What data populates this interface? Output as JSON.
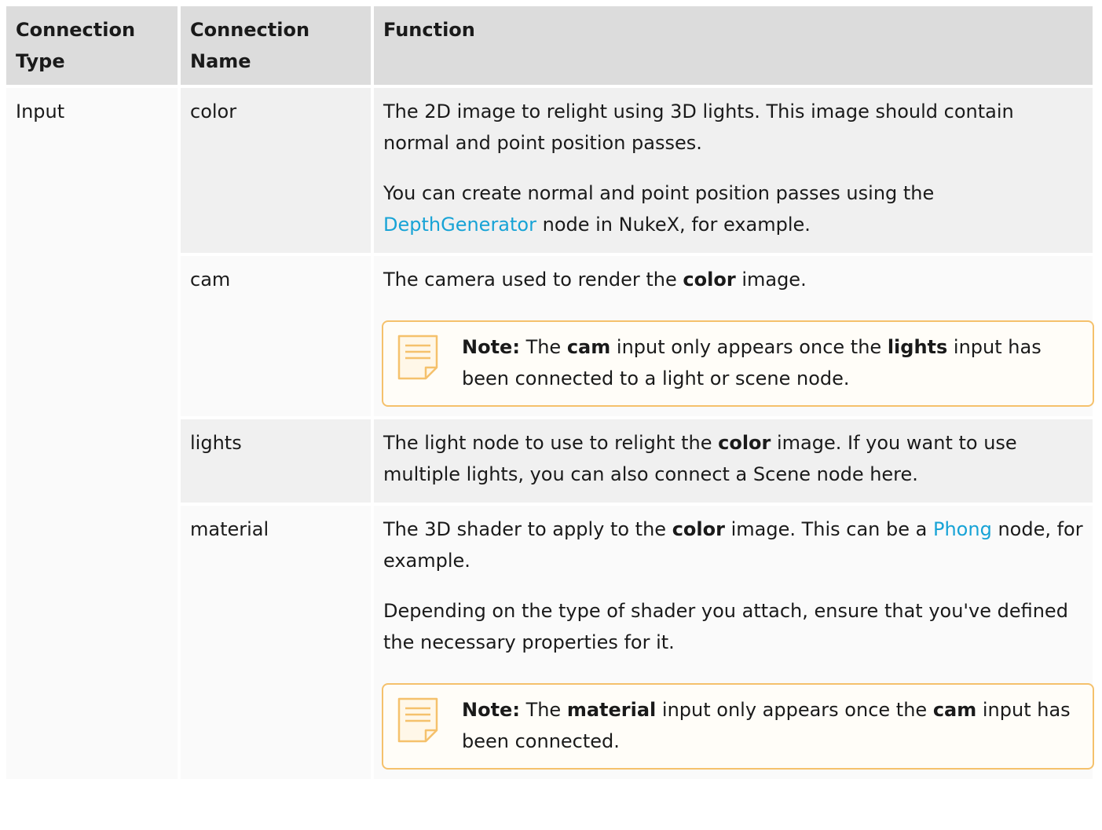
{
  "table": {
    "headers": [
      "Connection Type",
      "Connection Name",
      "Function"
    ],
    "rows": [
      {
        "type": "Input",
        "name": "color",
        "p1": "The 2D image to relight using 3D lights. This image should contain normal and point position passes.",
        "p2_pre": "You can create normal and point position passes using the ",
        "p2_link": "DepthGenerator",
        "p2_post": " node in NukeX, for example."
      },
      {
        "name": "cam",
        "p1_pre": "The camera used to render the ",
        "p1_bold": "color",
        "p1_post": " image.",
        "note": {
          "label": "Note:",
          "t1": " The ",
          "b1": "cam",
          "t2": " input only appears once the ",
          "b2": "lights",
          "t3": " input has been connected to a light or scene node."
        }
      },
      {
        "name": "lights",
        "p1_pre": "The light node to use to relight the ",
        "p1_bold": "color",
        "p1_post": " image. If you want to use multiple lights, you can also connect a Scene node here."
      },
      {
        "name": "material",
        "p1_pre": "The 3D shader to apply to the ",
        "p1_bold": "color",
        "p1_mid": " image. This can be a ",
        "p1_link": "Phong",
        "p1_post": " node, for example.",
        "p2": "Depending on the type of shader you attach, ensure that you've defined the necessary properties for it.",
        "note": {
          "label": "Note:",
          "t1": " The ",
          "b1": "material",
          "t2": " input only appears once the ",
          "b2": "cam",
          "t3": " input has been connected."
        }
      }
    ]
  },
  "colors": {
    "header_bg": "#dcdcdc",
    "row_gray": "#f0f0f0",
    "row_light": "#fafafa",
    "link": "#17a3d6",
    "note_border": "#f5c16c"
  },
  "icons": {
    "note": "note-icon"
  }
}
